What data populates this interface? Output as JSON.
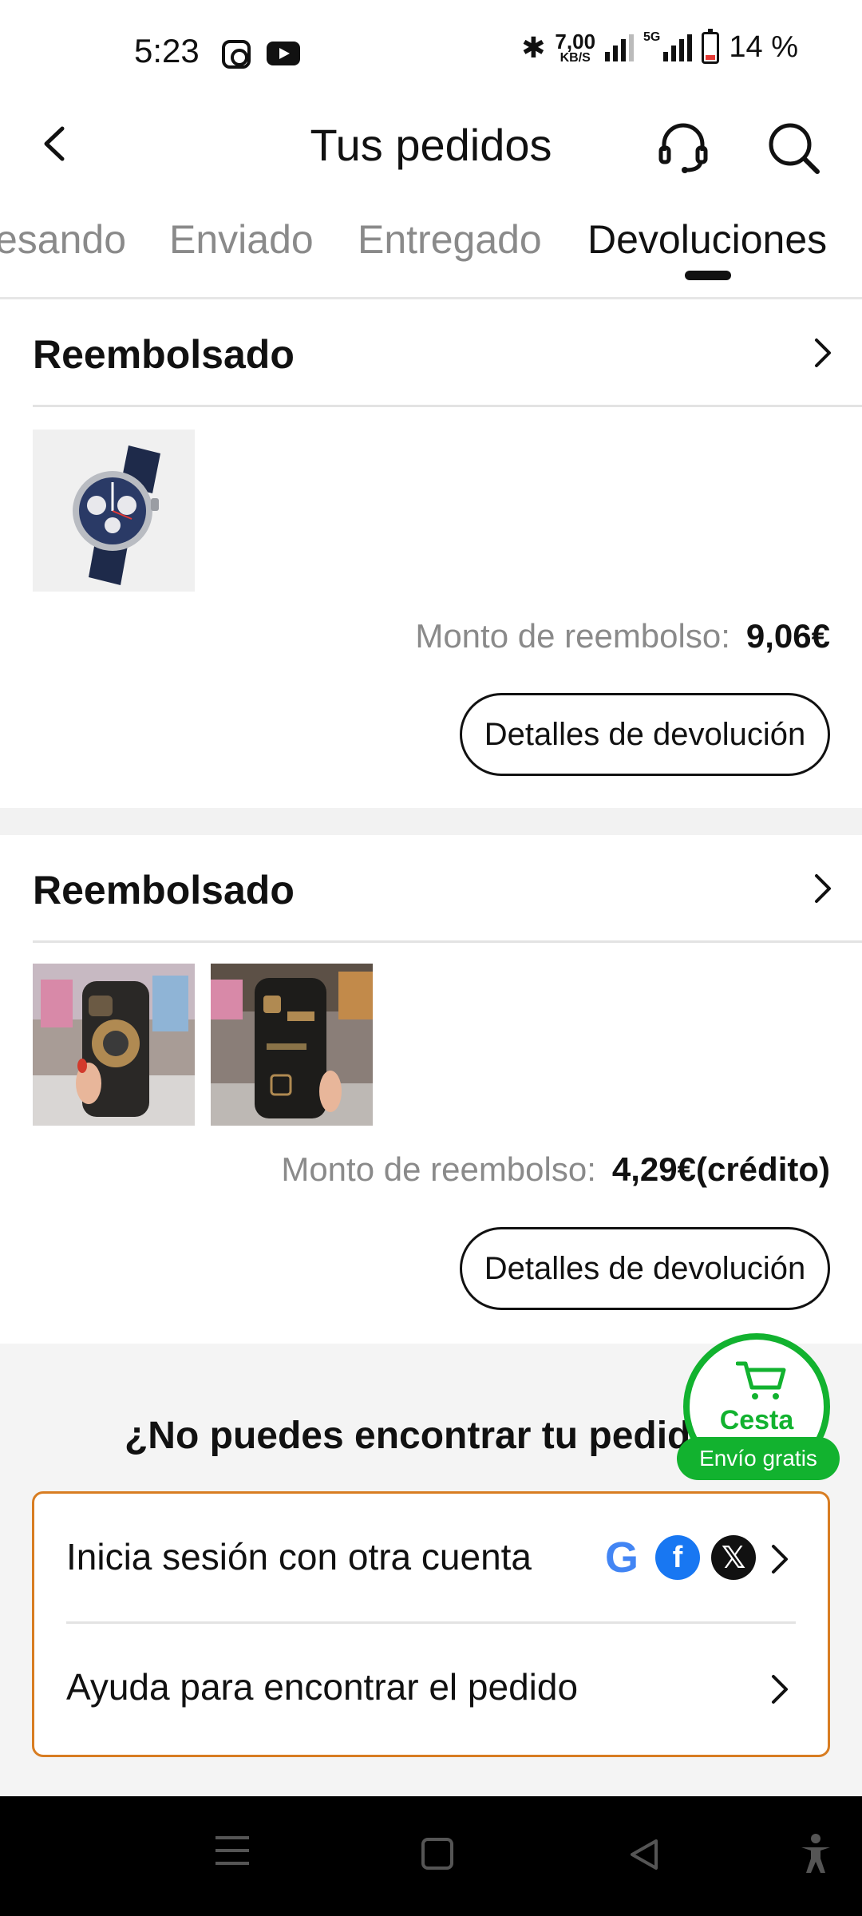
{
  "status_bar": {
    "time": "5:23",
    "speed_value": "7,00",
    "speed_unit": "KB/S",
    "network": "5G",
    "battery": "14 %"
  },
  "header": {
    "title": "Tus pedidos"
  },
  "tabs": [
    {
      "label": "esando",
      "active": false
    },
    {
      "label": "Enviado",
      "active": false
    },
    {
      "label": "Entregado",
      "active": false
    },
    {
      "label": "Devoluciones",
      "active": true
    }
  ],
  "orders": [
    {
      "status": "Reembolsado",
      "refund_label": "Monto de reembolso:",
      "refund_amount": "9,06€",
      "button_label": "Detalles de devolución",
      "items": [
        "watch-image"
      ]
    },
    {
      "status": "Reembolsado",
      "refund_label": "Monto de reembolso:",
      "refund_amount": "4,29€(crédito)",
      "button_label": "Detalles de devolución",
      "items": [
        "phone-case-image-1",
        "phone-case-image-2"
      ]
    }
  ],
  "help": {
    "title": "¿No puedes encontrar tu pedido?",
    "options": [
      {
        "label": "Inicia sesión con otra cuenta"
      },
      {
        "label": "Ayuda para encontrar el pedido"
      }
    ]
  },
  "cart": {
    "label": "Cesta",
    "badge": "Envío gratis"
  },
  "colors": {
    "accent_green": "#12b22f",
    "box_border_orange": "#d87d22"
  }
}
